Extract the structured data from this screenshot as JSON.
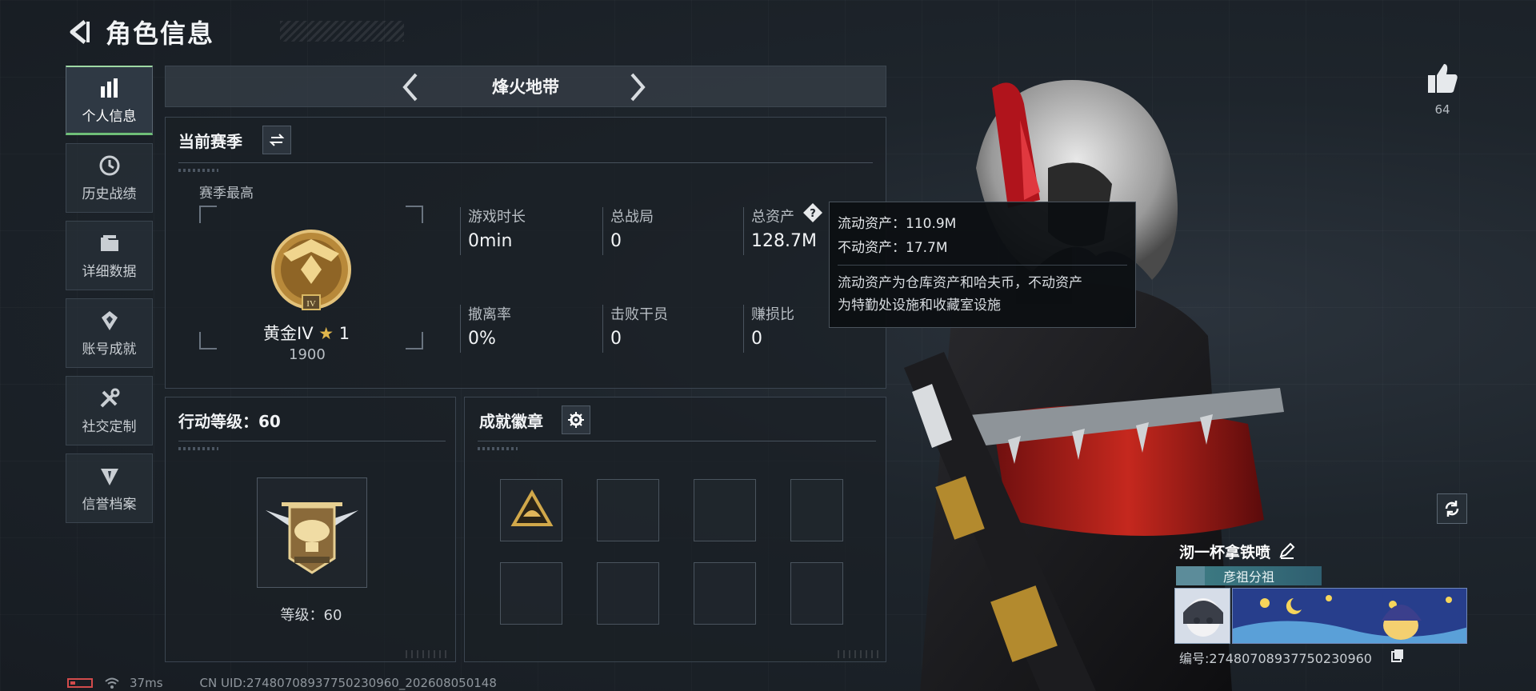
{
  "header": {
    "title": "角色信息"
  },
  "sidebar": {
    "items": [
      {
        "label": "个人信息",
        "icon": "bar-chart-icon",
        "active": true
      },
      {
        "label": "历史战绩",
        "icon": "history-clock-icon",
        "active": false
      },
      {
        "label": "详细数据",
        "icon": "folder-icon",
        "active": false
      },
      {
        "label": "账号成就",
        "icon": "achievement-icon",
        "active": false
      },
      {
        "label": "社交定制",
        "icon": "tools-icon",
        "active": false
      },
      {
        "label": "信誉档案",
        "icon": "reputation-icon",
        "active": false
      }
    ]
  },
  "mode": {
    "title": "烽火地带"
  },
  "season": {
    "title": "当前赛季",
    "best_label": "赛季最高",
    "rank_name": "黄金IV",
    "rank_stars": "1",
    "rank_score": "1900",
    "stats": [
      {
        "label": "游戏时长",
        "value": "0min"
      },
      {
        "label": "总战局",
        "value": "0"
      },
      {
        "label": "总资产",
        "value": "128.7M"
      },
      {
        "label": "撤离率",
        "value": "0%"
      },
      {
        "label": "击败干员",
        "value": "0"
      },
      {
        "label": "赚损比",
        "value": "0"
      }
    ]
  },
  "tooltip": {
    "liquid": "流动资产：110.9M",
    "fixed": "不动资产：17.7M",
    "desc_line1": "流动资产为仓库资产和哈夫币，不动资产",
    "desc_line2": "为特勤处设施和收藏室设施"
  },
  "action_level": {
    "title": "行动等级：60",
    "level_label": "等级：60"
  },
  "achievements": {
    "title": "成就徽章",
    "slots": 8
  },
  "profile": {
    "likes": "64",
    "name": "沏一杯拿铁喷",
    "guild": "彦祖分祖",
    "id_text": "编号:27480708937750230960"
  },
  "footer": {
    "ping": "37ms",
    "uid": "CN UID:27480708937750230960_202608050148"
  },
  "colors": {
    "accent_green": "#6fbf78",
    "gold": "#c9a24a",
    "tooltip_bg": "#0c0f12"
  }
}
